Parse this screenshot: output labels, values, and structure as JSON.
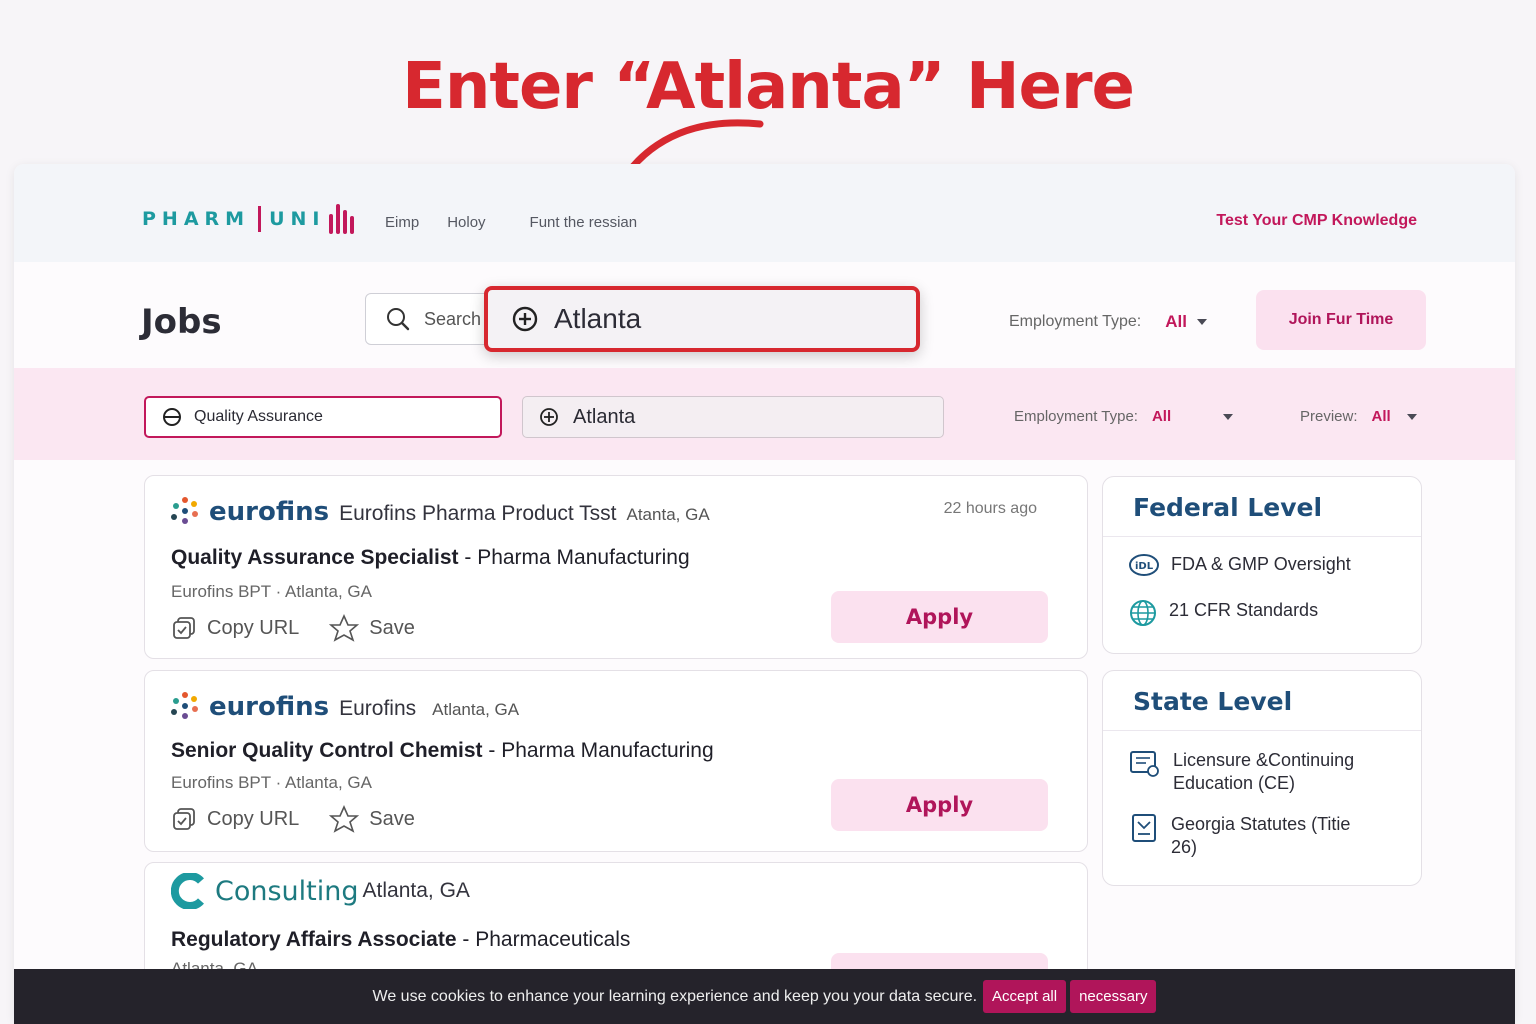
{
  "annotation": {
    "title": "Enter “Atlanta” Here"
  },
  "nav": {
    "logo_part1": "PHARM",
    "logo_part2": "UNI",
    "links": [
      "Eimp",
      "Holoy",
      "Funt the ressian"
    ],
    "cta": "Test Your CMP Knowledge"
  },
  "header": {
    "title": "Jobs",
    "search_placeholder": "Search",
    "location_value": "Atlanta",
    "employment_label": "Employment Type:",
    "employment_value": "All",
    "join_button": "Join Fur Time"
  },
  "filters": {
    "keyword": "Quality Assurance",
    "location": "Atlanta",
    "employment_label": "Employment Type:",
    "employment_value": "All",
    "preview_label": "Preview:",
    "preview_value": "All"
  },
  "jobs": [
    {
      "brand": "eurofins",
      "company": "Eurofins Pharma Product Tsst",
      "location": "Atanta, GA",
      "posted": "22 hours ago",
      "title": "Quality Assurance Specialist",
      "category": "Pharma Manufacturing",
      "employer": "Eurofins BPT",
      "meta_location": "Atlanta, GA",
      "copy_label": "Copy URL",
      "save_label": "Save",
      "apply_label": "Apply"
    },
    {
      "brand": "eurofins",
      "company": "Eurofins",
      "location": "Atlanta, GA",
      "title": "Senior Quality Control Chemist",
      "category": "Pharma Manufacturing",
      "employer": "Eurofins BPT",
      "meta_location": "Atlanta, GA",
      "copy_label": "Copy URL",
      "save_label": "Save",
      "apply_label": "Apply"
    },
    {
      "brand": "Consulting",
      "location": "Atlanta, GA",
      "title": "Regulatory Affairs Associate",
      "category": "Pharmaceuticals",
      "meta_location": "Atlanta, GA"
    }
  ],
  "sidebar": {
    "federal": {
      "title": "Federal Level",
      "items": [
        "FDA & GMP Oversight",
        "21 CFR Standards"
      ]
    },
    "state": {
      "title": "State Level",
      "items": [
        "Licensure &Continuing Education (CE)",
        "Georgia Statutes (Titie 26)"
      ]
    }
  },
  "cookie": {
    "message": "We use cookies to enhance your learning experience and keep you your data secure.",
    "accept_all": "Accept all",
    "necessary": "necessary"
  },
  "colors": {
    "accent": "#c2185b",
    "annotation_red": "#d7282f",
    "brand_teal": "#1d9aa0",
    "heading_blue": "#1f4e79"
  }
}
